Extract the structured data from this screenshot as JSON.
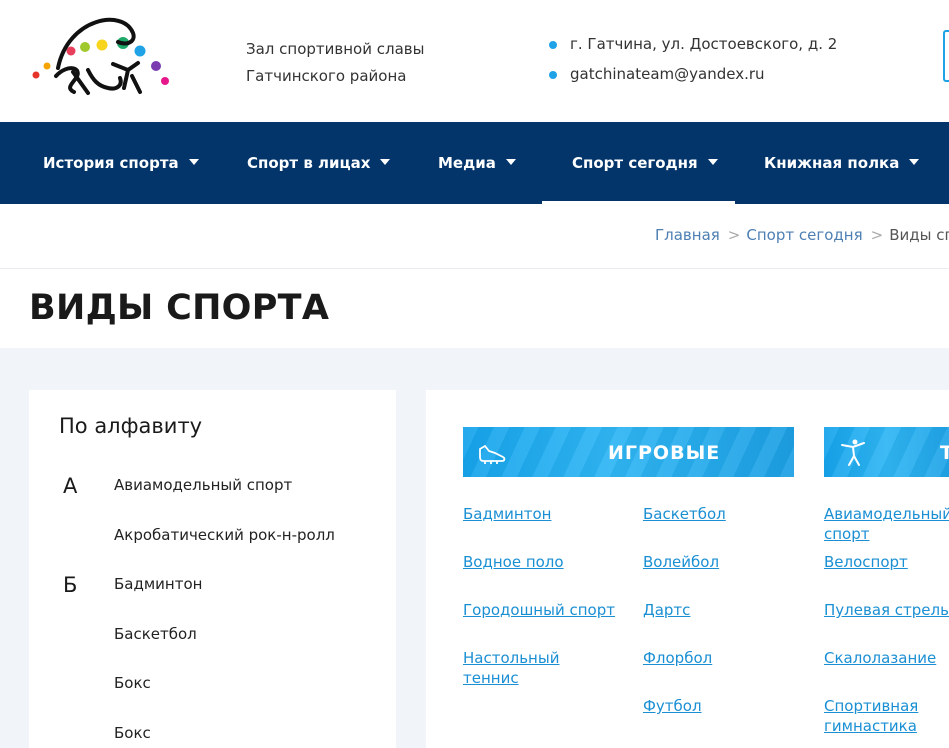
{
  "header": {
    "tagline_line1": "Зал спортивной славы",
    "tagline_line2": "Гатчинского района",
    "address": "г. Гатчина, ул. Достоевского, д. 2",
    "email": "gatchinateam@yandex.ru"
  },
  "nav": {
    "items": [
      {
        "label": "История спорта"
      },
      {
        "label": "Спорт в лицах"
      },
      {
        "label": "Медиа"
      },
      {
        "label": "Спорт сегодня"
      },
      {
        "label": "Книжная полка"
      }
    ]
  },
  "breadcrumb": {
    "home": "Главная",
    "section": "Спорт сегодня",
    "current": "Виды спорт"
  },
  "page": {
    "title": "ВИДЫ СПОРТА"
  },
  "sidebar": {
    "heading": "По алфавиту",
    "letter_a": "А",
    "letter_b": "Б",
    "items": [
      "Авиамодельный спорт",
      "Акробатический рок-н-ролл",
      "Бадминтон",
      "Баскетбол",
      "Бокс",
      "Бокс"
    ]
  },
  "categories": {
    "game": {
      "title": "ИГРОВЫЕ",
      "col1": [
        "Бадминтон",
        "Водное поло",
        "Городошный спорт",
        "Настольный теннис"
      ],
      "col2": [
        "Баскетбол",
        "Волейбол",
        "Дартс",
        "Флорбол",
        "Футбол"
      ]
    },
    "second": {
      "title": "Т",
      "col1": [
        "Авиамодельный спорт",
        "Велоспорт",
        "Пулевая стрельба",
        "Скалолазание",
        "Спортивная гимнастика"
      ]
    }
  },
  "colors": {
    "nav_bg": "#03356b",
    "accent": "#1fa3e6",
    "link": "#1a8fd3",
    "content_bg": "#f1f5f9"
  },
  "icons": [
    "logo-figures",
    "location-dot",
    "email-dot",
    "caret-down-icon",
    "sneaker-icon",
    "gymnast-icon"
  ]
}
